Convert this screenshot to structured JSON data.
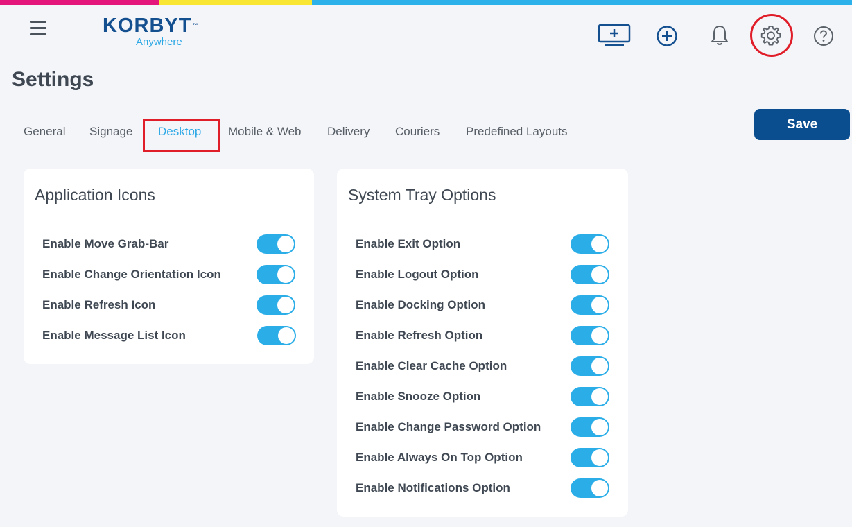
{
  "app": {
    "brand_main": "KORBYT",
    "brand_tm": "™",
    "brand_sub": "Anywhere",
    "colors": {
      "brand_blue": "#14508f",
      "accent_blue": "#2ea8e6",
      "toggle_on": "#2baee8",
      "highlight_red": "#e01e2a",
      "stripe_pink": "#e4167c",
      "stripe_yellow": "#f9e534",
      "stripe_cyan": "#2cb1ea"
    }
  },
  "header": {
    "icons": [
      "menu-icon",
      "display-add-icon",
      "plus-circle-icon",
      "bell-icon",
      "gear-icon",
      "help-icon"
    ]
  },
  "page": {
    "title": "Settings",
    "save_label": "Save"
  },
  "tabs": [
    {
      "label": "General",
      "active": false
    },
    {
      "label": "Signage",
      "active": false
    },
    {
      "label": "Desktop",
      "active": true
    },
    {
      "label": "Mobile & Web",
      "active": false
    },
    {
      "label": "Delivery",
      "active": false
    },
    {
      "label": "Couriers",
      "active": false
    },
    {
      "label": "Predefined Layouts",
      "active": false
    }
  ],
  "application_icons": {
    "title": "Application Icons",
    "items": [
      {
        "label": "Enable Move Grab-Bar",
        "enabled": true
      },
      {
        "label": "Enable Change Orientation Icon",
        "enabled": true
      },
      {
        "label": "Enable Refresh Icon",
        "enabled": true
      },
      {
        "label": "Enable Message List Icon",
        "enabled": true
      }
    ]
  },
  "system_tray": {
    "title": "System Tray Options",
    "items": [
      {
        "label": "Enable Exit Option",
        "enabled": true
      },
      {
        "label": "Enable Logout Option",
        "enabled": true
      },
      {
        "label": "Enable Docking Option",
        "enabled": true
      },
      {
        "label": "Enable Refresh Option",
        "enabled": true
      },
      {
        "label": "Enable Clear Cache Option",
        "enabled": true
      },
      {
        "label": "Enable Snooze Option",
        "enabled": true
      },
      {
        "label": "Enable Change Password Option",
        "enabled": true
      },
      {
        "label": "Enable Always On Top Option",
        "enabled": true
      },
      {
        "label": "Enable Notifications Option",
        "enabled": true
      }
    ]
  }
}
